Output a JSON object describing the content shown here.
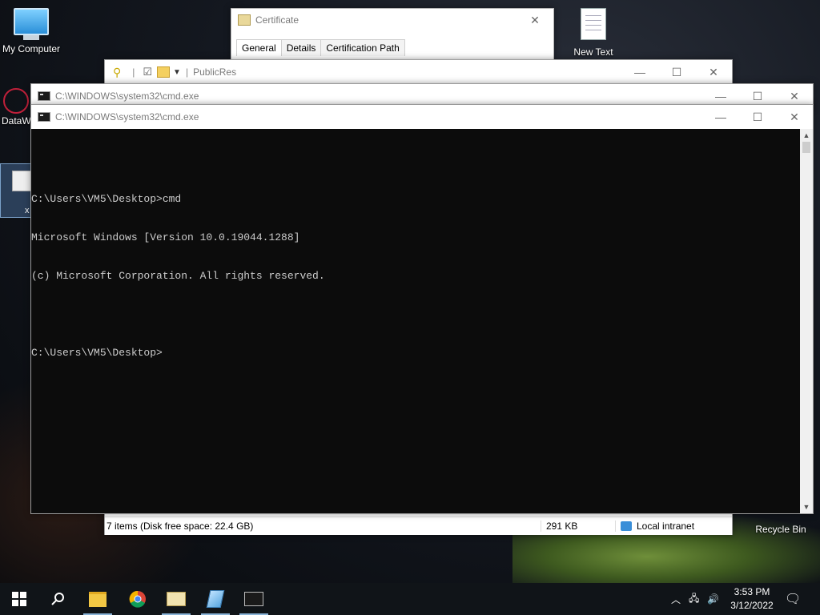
{
  "desktop": {
    "icons": {
      "my_computer": "My Computer",
      "datawedge": "DataW",
      "new_text": "New Text",
      "recycle_bin": "Recycle Bin",
      "selected_partial": "x"
    }
  },
  "certificate_window": {
    "title": "Certificate",
    "tabs": [
      "General",
      "Details",
      "Certification Path"
    ],
    "active_tab": "General"
  },
  "explorer_window": {
    "title": "PublicRes",
    "status": {
      "items": "7 items (Disk free space: 22.4 GB)",
      "size": "291 KB",
      "zone": "Local intranet"
    }
  },
  "cmd_back": {
    "title": "C:\\WINDOWS\\system32\\cmd.exe"
  },
  "cmd_front": {
    "title": "C:\\WINDOWS\\system32\\cmd.exe",
    "lines": [
      "C:\\Users\\VM5\\Desktop>cmd",
      "Microsoft Windows [Version 10.0.19044.1288]",
      "(c) Microsoft Corporation. All rights reserved.",
      "",
      "C:\\Users\\VM5\\Desktop>"
    ]
  },
  "taskbar": {
    "apps": [
      "start-icon",
      "search-icon",
      "file-explorer-icon",
      "chrome-icon",
      "certificate-app-icon",
      "notepad-app-icon",
      "cmd-app-icon"
    ],
    "time": "3:53 PM",
    "date": "3/12/2022"
  },
  "colors": {
    "console_bg": "#0c0c0c",
    "console_fg": "#cccccc",
    "taskbar_bg": "#101418"
  }
}
